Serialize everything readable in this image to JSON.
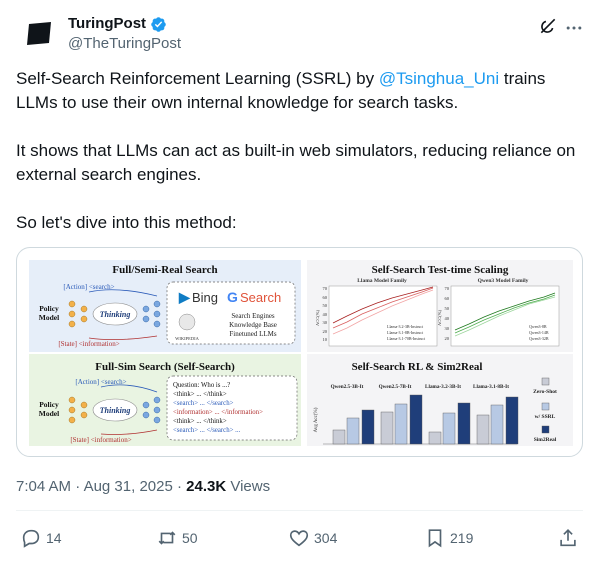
{
  "author": {
    "display_name": "TuringPost",
    "handle": "@TheTuringPost"
  },
  "tweet": {
    "p1_before": "Self-Search Reinforcement Learning (SSRL) by ",
    "p1_mention": "@Tsinghua_Uni",
    "p1_after": " trains LLMs to use their own internal knowledge for search tasks.",
    "p2": "It shows that LLMs can act as built-in web simulators, reducing reliance on external search engines.",
    "p3": "So let's dive into this method:"
  },
  "figure": {
    "left_top_title": "Full/Semi-Real Search",
    "action_tag": "[Action] <search>",
    "state_tag": "[State] <information>",
    "policy_model": [
      "Policy",
      "Model"
    ],
    "thinking": "Thinking",
    "bing": "Bing",
    "google_search": "Search",
    "wikipedia": "WIKIPEDIA",
    "engines_list": [
      "Search Engines",
      "Knowledge Base",
      "Finetuned LLMs"
    ],
    "left_bottom_title": "Full-Sim Search (Self-Search)",
    "qa_lines": [
      "Question: Who is ...?",
      "<think> ... </think>",
      "<search> ... </search>",
      "<information> ... </information>",
      "<think> ... </think>",
      "<search> ... </search> ..."
    ],
    "right_top_title": "Self-Search Test-time Scaling",
    "llama_family": "Llama Model Family",
    "qwen_family": "Qwen3 Model Family",
    "acc_label": "ACC(%)",
    "y_ticks_left": [
      "70",
      "60",
      "50",
      "40",
      "30",
      "20",
      "10"
    ],
    "y_ticks_right": [
      "70",
      "60",
      "50",
      "40",
      "30",
      "20"
    ],
    "llama_legend": [
      "Llama-3.2-3B-Instruct",
      "Llama-3.1-8B-Instruct",
      "Llama-3.1-70B-Instruct"
    ],
    "qwen_legend": [
      "Qwen3-8B",
      "Qwen3-14B",
      "Qwen3-32B"
    ],
    "right_bottom_title": "Self-Search RL & Sim2Real",
    "bar_groups": [
      "Qwen2.5-3B-It",
      "Qwen2.5-7B-It",
      "Llama-3.2-3B-It",
      "Llama-3.1-8B-It"
    ],
    "avg_acc_label": "Avg Acc(%)",
    "bar_legend": [
      "Zero-Shot",
      "w/ SSRL",
      "Sim2Real"
    ]
  },
  "colors": {
    "accent": "#1d9bf0",
    "muted": "#536471",
    "zero_shot": "#c9ccd6",
    "ssrl": "#b7c9e4",
    "sim2real": "#1f3e7a"
  },
  "meta": {
    "time": "7:04 AM",
    "date": "Aug 31, 2025",
    "views_count": "24.3K",
    "views_label": "Views"
  },
  "actions": {
    "replies": "14",
    "reposts": "50",
    "likes": "304",
    "bookmarks": "219"
  }
}
